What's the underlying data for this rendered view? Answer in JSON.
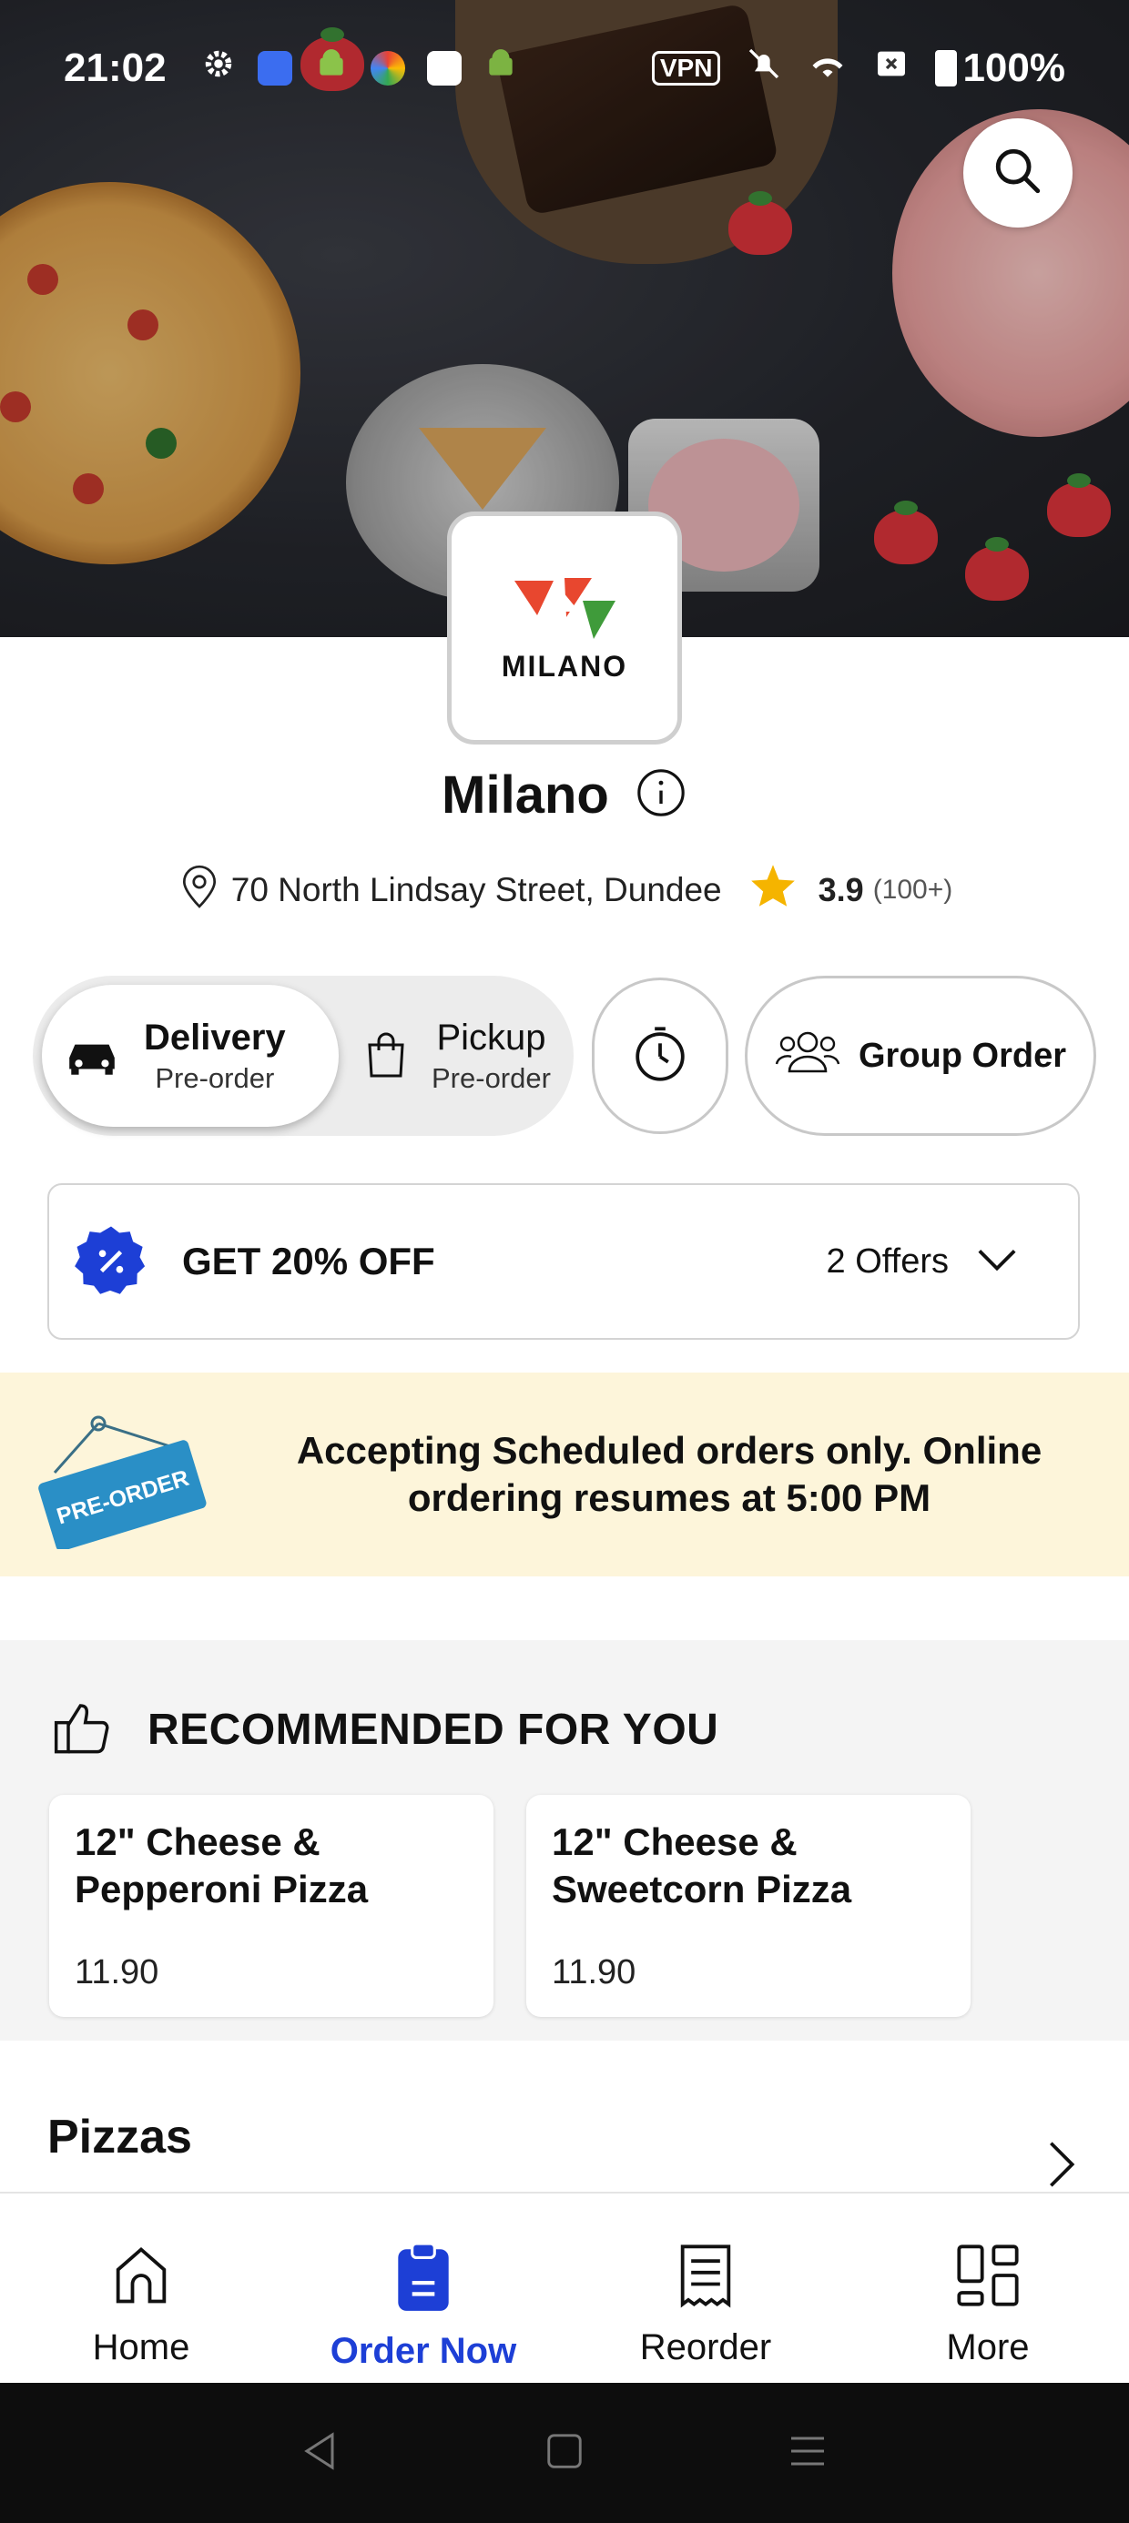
{
  "status_bar": {
    "time": "21:02",
    "vpn_label": "VPN",
    "battery": "100%"
  },
  "restaurant": {
    "name": "Milano",
    "logo_text": "MILANO",
    "address": "70 North Lindsay Street, Dundee",
    "rating": "3.9",
    "rating_count": "(100+)"
  },
  "order_modes": {
    "delivery": {
      "label": "Delivery",
      "sub": "Pre-order"
    },
    "pickup": {
      "label": "Pickup",
      "sub": "Pre-order"
    },
    "group_order_label": "Group Order"
  },
  "offers": {
    "title": "GET 20% OFF",
    "count": "2 Offers"
  },
  "banner": {
    "tag": "PRE-ORDER",
    "message": "Accepting Scheduled orders only. Online ordering resumes at 5:00 PM"
  },
  "recommended": {
    "heading": "RECOMMENDED FOR YOU",
    "items": [
      {
        "name": "12\" Cheese & Pepperoni Pizza",
        "price": "11.90"
      },
      {
        "name": "12\" Cheese & Sweetcorn Pizza",
        "price": "11.90"
      }
    ]
  },
  "section": {
    "title": "Pizzas"
  },
  "nav": {
    "items": [
      {
        "label": "Home",
        "icon": "home-icon"
      },
      {
        "label": "Order Now",
        "icon": "order-icon"
      },
      {
        "label": "Reorder",
        "icon": "receipt-icon"
      },
      {
        "label": "More",
        "icon": "grid-icon"
      }
    ],
    "active": "Order Now",
    "active_color": "#1d3fd6"
  },
  "colors": {
    "banner_bg": "#fdf5da",
    "offer_badge": "#1d3fd6",
    "star": "#f5b400",
    "tag_blue": "#2a8fc6"
  }
}
